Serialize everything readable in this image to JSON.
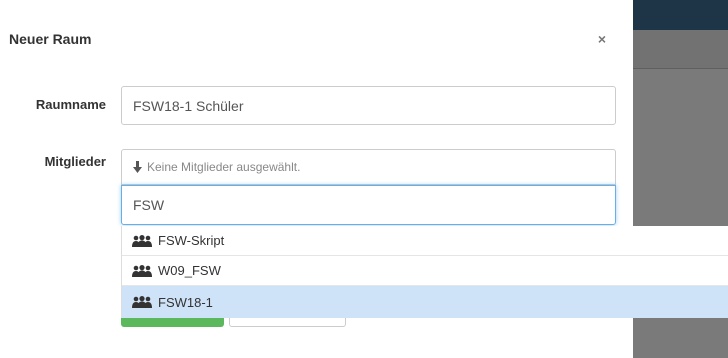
{
  "modal": {
    "title": "Neuer Raum",
    "close_label": "×"
  },
  "form": {
    "room_name_label": "Raumname",
    "room_name_value": "FSW18-1 Schüler",
    "members_label": "Mitglieder",
    "members_placeholder": "Keine Mitglieder ausgewählt.",
    "search_value": "FSW"
  },
  "dropdown": {
    "items": [
      {
        "label": "FSW-Skript",
        "icon": "group-icon"
      },
      {
        "label": "W09_FSW",
        "icon": "group-icon"
      },
      {
        "label": "FSW18-1",
        "icon": "group-icon",
        "highlighted": true
      }
    ]
  },
  "colors": {
    "highlight": "#cfe3f8",
    "save_button": "#5cb85c",
    "focus_border": "#66afe9",
    "backdrop_topbar": "#1e3548"
  }
}
